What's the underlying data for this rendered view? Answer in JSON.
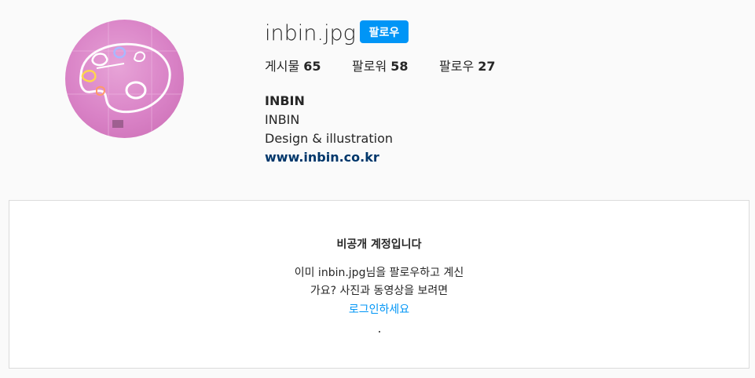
{
  "profile": {
    "username": "inbin.jpg",
    "follow_label": "팔로우",
    "stats": [
      {
        "label": "게시물",
        "value": "65"
      },
      {
        "label": "팔로워",
        "value": "58"
      },
      {
        "label": "팔로우",
        "value": "27"
      }
    ],
    "full_name": "INBIN",
    "bio_line_1": "INBIN",
    "bio_line_2": "Design & illustration",
    "website": "www.inbin.co.kr"
  },
  "private": {
    "title": "비공개 계정입니다",
    "message_line_1": "이미 inbin.jpg님을 팔로우하고 계신",
    "message_line_2": "가요? 사진과 동영상을 보려면",
    "login_label": "로그인하세요"
  },
  "colors": {
    "accent": "#0095f6",
    "link": "#00376b",
    "background": "#fafafa",
    "avatar": "#d982c6"
  }
}
